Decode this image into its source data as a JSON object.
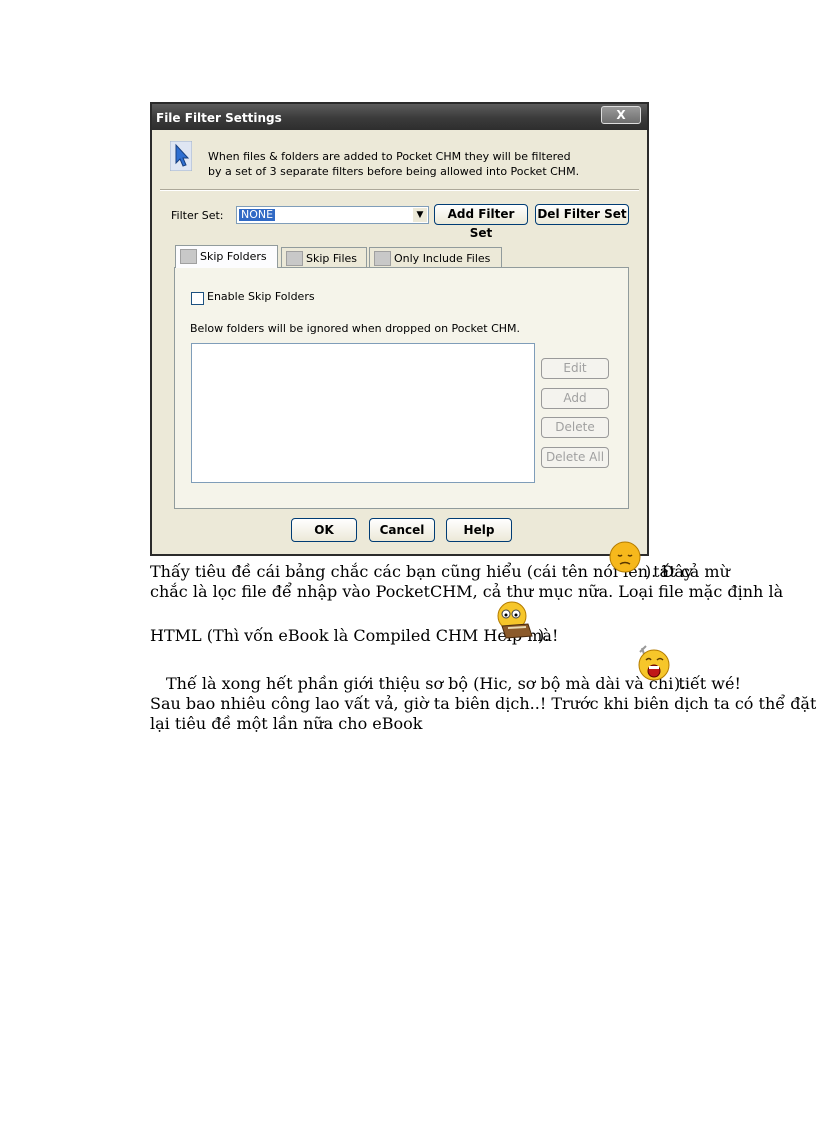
{
  "dialog": {
    "title": "File Filter Settings",
    "close_label": "X",
    "header_line1": "When files & folders are added to Pocket CHM they will be filtered",
    "header_line2": "by a set of 3 separate filters before being allowed into Pocket CHM.",
    "filter_set_label": "Filter Set:",
    "filter_set_value": "NONE",
    "add_filter_set": "Add Filter Set",
    "del_filter_set": "Del Filter Set",
    "tabs": [
      {
        "label": "Skip Folders"
      },
      {
        "label": "Skip Files"
      },
      {
        "label": "Only Include Files"
      }
    ],
    "enable_label": "Enable Skip Folders",
    "info": "Below folders will be ignored when dropped on Pocket CHM.",
    "side_buttons": [
      "Edit",
      "Add",
      "Delete",
      "Delete All"
    ],
    "ok": "OK",
    "cancel": "Cancel",
    "help": "Help"
  },
  "text": {
    "p1_line1": "Thấy tiêu đề cái bảng chắc các bạn cũng hiểu (cái tên nói lên tất cả mừ",
    "p1_line1_end": "). Đây",
    "p1_line2": "chắc là lọc file để nhập vào PocketCHM, cả thư mục nữa. Loại file mặc định là",
    "p1_line3": "HTML (Thì vốn eBook là Compiled CHM Help mà!",
    "p1_line3_end": ").",
    "p2_line1": "Thế là xong hết phần giới thiệu sơ bộ (Hic, sơ bộ mà dài và chi tiết wé!",
    "p2_line1_end": ").",
    "p2_line2": "Sau bao nhiêu công lao vất vả, giờ ta biên dịch..! Trước khi biên dịch ta có thể đặt",
    "p2_line3": "lại tiêu đề một lần nữa cho eBook"
  }
}
